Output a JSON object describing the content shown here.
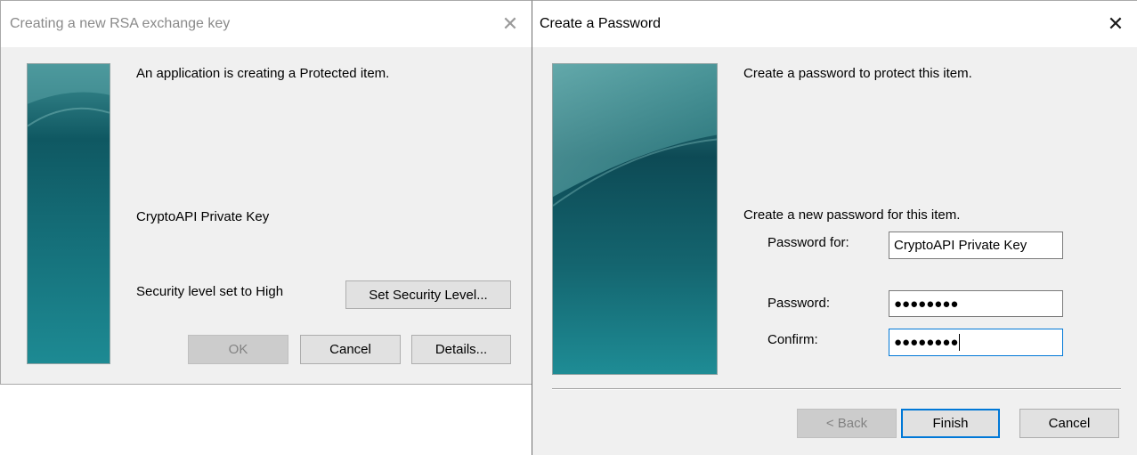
{
  "dialog1": {
    "title": "Creating a new RSA exchange key",
    "close_glyph": "✕",
    "message": "An application is creating a Protected item.",
    "item_name": "CryptoAPI Private Key",
    "security_text": "Security level set to High",
    "buttons": {
      "set_security": "Set Security Level...",
      "ok": "OK",
      "cancel": "Cancel",
      "details": "Details..."
    }
  },
  "dialog2": {
    "title": "Create a Password",
    "close_glyph": "✕",
    "intro": "Create a password to protect this item.",
    "instruction": "Create a new password for this item.",
    "password_for_label": "Password for:",
    "password_for_value": "CryptoAPI Private Key",
    "password_label": "Password:",
    "password_mask": "●●●●●●●●",
    "confirm_label": "Confirm:",
    "confirm_mask": "●●●●●●●●",
    "buttons": {
      "back": "< Back",
      "finish": "Finish",
      "cancel": "Cancel"
    }
  },
  "colors": {
    "banner_light": "#3e8f93",
    "banner_dark": "#0d4a55",
    "focus_blue": "#0078d7"
  }
}
